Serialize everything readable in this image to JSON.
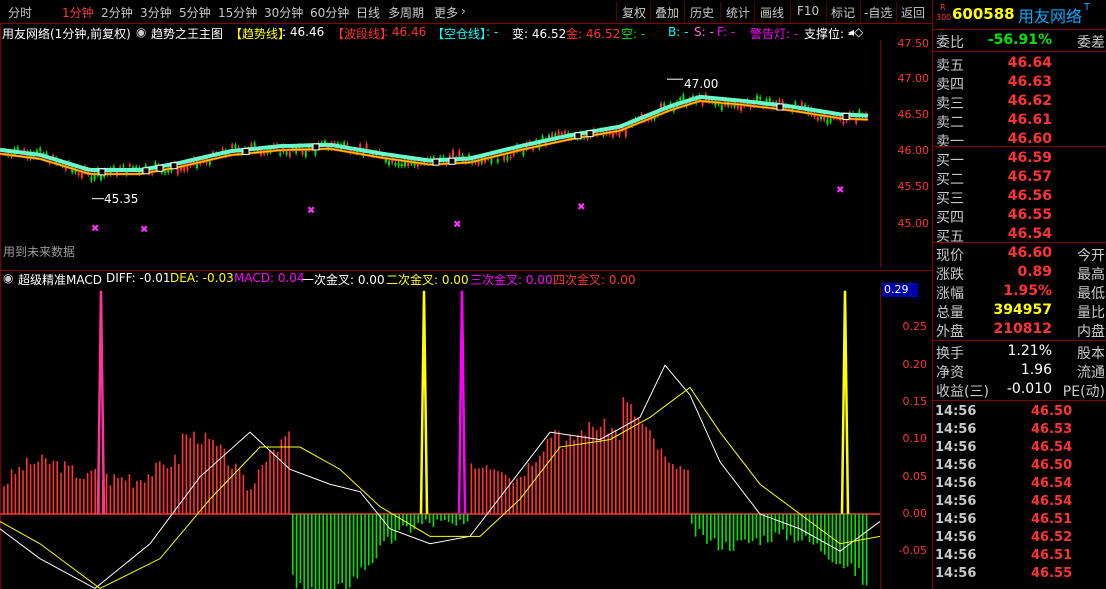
{
  "toolbar": {
    "periods": [
      "分时",
      "1分钟",
      "2分钟",
      "3分钟",
      "5分钟",
      "15分钟",
      "30分钟",
      "60分钟",
      "日线",
      "多周期",
      "更多"
    ],
    "active_period": "1分钟",
    "more_arrow": "›",
    "right_buttons": [
      "复权",
      "叠加",
      "历史",
      "统计",
      "画线",
      "F10",
      "标记",
      "-自选",
      "返回"
    ]
  },
  "main_chart": {
    "stock_label": "用友网络(1分钟,前复权)",
    "indicator_name": "趋势之王主图",
    "trend_label": "【趋势线】",
    "trend_value": ": 46.46",
    "wave_label": "【波段线】",
    "wave_value": ": 46.46",
    "empty_label": "【空仓线】",
    "empty_value": ": -",
    "bian_label": "变: 46.52",
    "jin_label": "金: 46.52",
    "kong_label": "空: -",
    "b_label": "B: -",
    "s_label": "S: -",
    "f_label": "F: -",
    "alarm_label": "警告灯: -",
    "support_label": "支撑位: -",
    "future_note": "用到未来数据",
    "high_marker": "47.00",
    "low_marker": "45.35",
    "y_ticks": [
      "47.50",
      "47.00",
      "46.50",
      "46.00",
      "45.50",
      "45.00"
    ],
    "price_badge": "46.60"
  },
  "macd_chart": {
    "indicator_name": "超级精准MACD",
    "diff_label": "DIFF: -0.01",
    "dea_label": "DEA: -0.03",
    "macd_label": "MACD: 0.04",
    "cross1_label": "一次金叉: 0.00",
    "cross2_label": "二次金叉: 0.00",
    "cross3_label": "三次金叉: 0.00",
    "cross4_label": "四次金叉: 0.00",
    "y_ticks": [
      "0.25",
      "0.20",
      "0.15",
      "0.10",
      "0.05",
      "0.00",
      "-0.05"
    ],
    "value_badge": "0.29"
  },
  "sidebar": {
    "code": "600588",
    "name": "用友网络",
    "badge_r": "R",
    "badge_300": "300",
    "badge_t": "T",
    "weibi_label": "委比",
    "weibi_value": "-56.91%",
    "weicha_label": "委差",
    "asks": [
      {
        "label": "卖五",
        "price": "46.64"
      },
      {
        "label": "卖四",
        "price": "46.63"
      },
      {
        "label": "卖三",
        "price": "46.62"
      },
      {
        "label": "卖二",
        "price": "46.61"
      },
      {
        "label": "卖一",
        "price": "46.60"
      }
    ],
    "bids": [
      {
        "label": "买一",
        "price": "46.59"
      },
      {
        "label": "买二",
        "price": "46.57"
      },
      {
        "label": "买三",
        "price": "46.56"
      },
      {
        "label": "买四",
        "price": "46.55"
      },
      {
        "label": "买五",
        "price": "46.54"
      }
    ],
    "quote": [
      {
        "l": "现价",
        "v": "46.60",
        "r": "今开",
        "color": "#ff3333"
      },
      {
        "l": "涨跌",
        "v": "0.89",
        "r": "最高",
        "color": "#ff3333"
      },
      {
        "l": "涨幅",
        "v": "1.95%",
        "r": "最低",
        "color": "#ff3333"
      },
      {
        "l": "总量",
        "v": "394957",
        "r": "量比",
        "color": "#ffff00"
      },
      {
        "l": "外盘",
        "v": "210812",
        "r": "内盘",
        "color": "#ff3333"
      }
    ],
    "extra": [
      {
        "l": "换手",
        "v": "1.21%",
        "r": "股本"
      },
      {
        "l": "净资",
        "v": "1.96",
        "r": "流通"
      },
      {
        "l": "收益(三)",
        "v": "-0.010",
        "r": "PE(动)"
      }
    ],
    "ticks": [
      {
        "t": "14:56",
        "p": "46.50"
      },
      {
        "t": "14:56",
        "p": "46.53"
      },
      {
        "t": "14:56",
        "p": "46.54"
      },
      {
        "t": "14:56",
        "p": "46.50"
      },
      {
        "t": "14:56",
        "p": "46.54"
      },
      {
        "t": "14:56",
        "p": "46.54"
      },
      {
        "t": "14:56",
        "p": "46.51"
      },
      {
        "t": "14:56",
        "p": "46.52"
      },
      {
        "t": "14:56",
        "p": "46.51"
      },
      {
        "t": "14:56",
        "p": "46.55"
      }
    ]
  },
  "colors": {
    "up": "#ff3333",
    "down": "#00e600",
    "border": "#800000",
    "trend": "#ff6600",
    "wave": "#66ffcc",
    "cross1": "#ff3399",
    "cross2": "#ffff00",
    "cross3": "#ff00ff"
  }
}
